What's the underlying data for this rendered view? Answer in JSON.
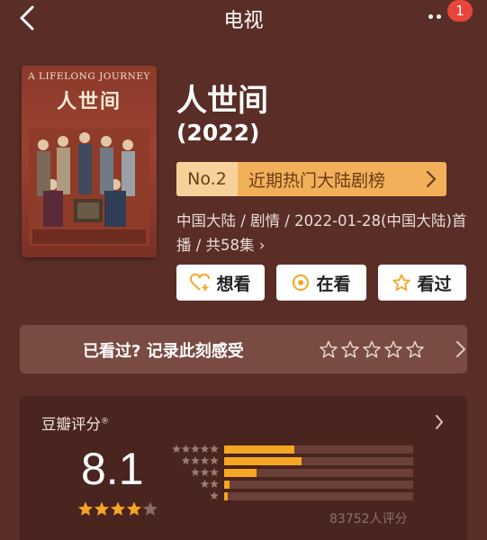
{
  "header": {
    "title": "电视",
    "notification_count": "1"
  },
  "poster": {
    "tagline": "A LIFELONG JOURNEY",
    "title_art": "人世间"
  },
  "show": {
    "title": "人世间",
    "year": "(2022)"
  },
  "ranking": {
    "number": "No.2",
    "label": "近期热门大陆剧榜"
  },
  "meta": {
    "line": "中国大陆 / 剧情 / 2022-01-28(中国大陆)首播 / 共58集 ›"
  },
  "actions": [
    {
      "label": "想看",
      "icon": "heart-plus-icon"
    },
    {
      "label": "在看",
      "icon": "target-icon"
    },
    {
      "label": "看过",
      "icon": "star-outline-icon"
    }
  ],
  "record": {
    "prompt": "已看过? 记录此刻感受",
    "stars_total": 5
  },
  "rating": {
    "label": "豆瓣评分",
    "mark": "®",
    "score": "8.1",
    "stars_filled": 4,
    "stars_total": 5,
    "distribution": [
      {
        "stars": 5,
        "fraction": 0.37
      },
      {
        "stars": 4,
        "fraction": 0.41
      },
      {
        "stars": 3,
        "fraction": 0.17
      },
      {
        "stars": 2,
        "fraction": 0.03
      },
      {
        "stars": 1,
        "fraction": 0.02
      }
    ],
    "count": "83752人评分"
  },
  "colors": {
    "background": "#5a2e26",
    "accent_orange": "#f5a623",
    "badge_red": "#e8453c"
  }
}
